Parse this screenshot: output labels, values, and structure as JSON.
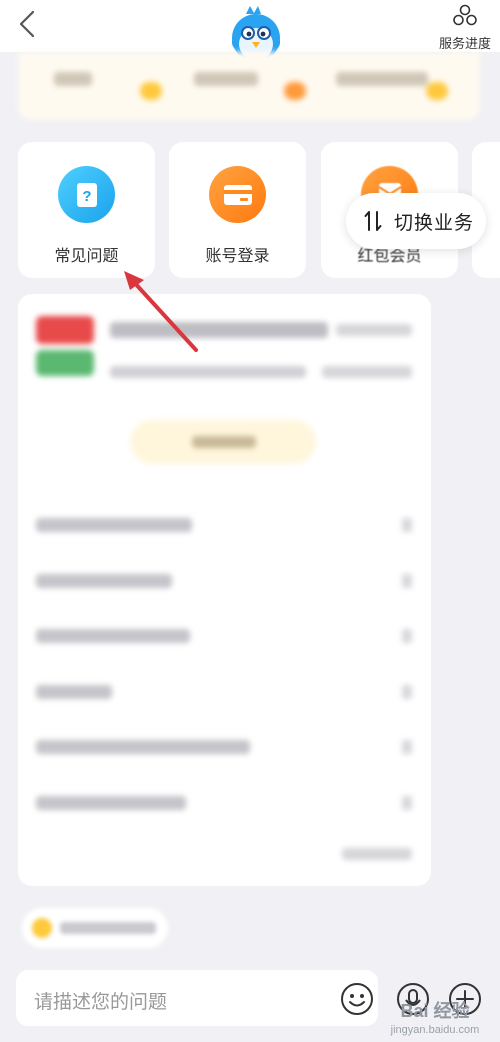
{
  "header": {
    "service_progress_label": "服务进度"
  },
  "cards": [
    {
      "label": "常见问题",
      "icon": "question-doc-icon",
      "color": "#2bb5f0"
    },
    {
      "label": "账号登录",
      "icon": "card-icon",
      "color": "#ff8a1c"
    },
    {
      "label": "红包会员",
      "icon": "envelope-icon",
      "color": "#ff8a1c"
    }
  ],
  "switch_business": {
    "label": "切换业务",
    "icon": "swap-arrows-icon"
  },
  "input": {
    "placeholder": "请描述您的问题"
  },
  "watermark": {
    "main": "Bai 经验",
    "sub": "jingyan.baidu.com"
  },
  "colors": {
    "accent_blue": "#2bb5f0",
    "accent_orange": "#ff8a1c",
    "annotation_arrow": "#d9363e"
  }
}
